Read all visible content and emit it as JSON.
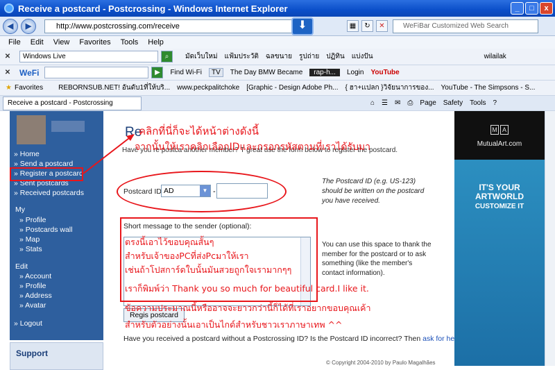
{
  "window": {
    "title": "Receive a postcard - Postcrossing - Windows Internet Explorer",
    "buttons": [
      "_",
      "□",
      "x"
    ]
  },
  "address_bar": {
    "url": "http://www.postcrossing.com/receive",
    "search_placeholder": "WeFiBar Customized Web Search"
  },
  "menu": [
    "File",
    "Edit",
    "View",
    "Favorites",
    "Tools",
    "Help"
  ],
  "toolbar_live": {
    "label": "Windows Live",
    "links": [
      "มัดเว็บใหม่",
      "แฟ้มประวัติ",
      "ฉลขนาย",
      "รูปถ่าย",
      "ปฏิทิน",
      "แบ่งปัน"
    ],
    "user": "wilailak"
  },
  "toolbar_wefi": {
    "label": "WeFi",
    "find_wifi": "Find Wi-Fi",
    "tv": "TV",
    "news": "The Day BMW Became",
    "media": "rap-h...",
    "login": "Login",
    "youtube": "YouTube"
  },
  "favorites_bar": {
    "label": "Favorites",
    "items": [
      "REBORNSUB.NET! อันดับ1ที่ให้บริ...",
      "www.peckpalitchoke",
      "[Graphic - Design Adobe Ph...",
      "{ ฮา+เเปลก }วิจัยนาการของ...",
      "YouTube - The Simpsons - S..."
    ]
  },
  "tab_bar": {
    "tab_title": "Receive a postcard - Postcrossing",
    "tools": [
      "Page",
      "Safety",
      "Tools"
    ]
  },
  "sidebar": {
    "links_main": [
      "» Home",
      "» Send a postcard",
      "» Register a postcard",
      "» Sent postcards",
      "» Received postcards"
    ],
    "my_heading": "My",
    "links_my": [
      "» Profile",
      "» Postcards wall",
      "» Map",
      "» Stats"
    ],
    "edit_heading": "Edit",
    "links_edit": [
      "» Account",
      "» Profile",
      "» Address",
      "» Avatar"
    ],
    "logout": "» Logout",
    "support": "Support"
  },
  "main": {
    "title": "Re",
    "intro": "Have you re                    postca                    another member? T            great            use the form below to register the postcard.",
    "postcard_id_label": "Postcard ID:",
    "postcard_id_prefix": "AD",
    "dash": "-",
    "hint": "The Postcard ID (e.g. US-123) should be written on the postcard you have received.",
    "message_label": "Short message to the sender (optional):",
    "message_hint": "You can use this space to thank the member for the postcard or to ask something (like the member's contact information).",
    "register_button": "Regis  postcard",
    "bottom_question": "Have you received a postcard without a Postcrossing ID? Is the Postcard ID incorrect? Then",
    "bottom_link": "ask for help",
    "bottom_end": ".",
    "copyright": "© Copyright 2004-2010 by Paulo Magalhães"
  },
  "ad": {
    "logo": [
      "M",
      "A"
    ],
    "brand": "MutualArt.com",
    "headline_1": "IT'S YOUR",
    "headline_2": "ARTWORLD",
    "cta": "CUSTOMIZE IT"
  },
  "annotations": {
    "a1": "คลิกที่นี่ก็จะได้หน้าต่างดังนี้",
    "a2": "จากนั้นให้เราคลิกเลือกIDและกรอกรหัสตามที่เราได้รับมา",
    "m1": "ตรงนี้เอาไว้ขอบคุณสั้นๆ",
    "m2": "สำหรับเจ้าของPCที่ส่งPcมาให้เรา",
    "m3": "เช่นถ้าโปสการ์ดใบนั้นมันสวยถูกใจเรามากๆๆ",
    "m4": "เราก็พิมพ์ว่า Thank you so much for beautiful card.I like it.",
    "m5": "ข้อความประมาณนี้หรืออาจจะยาวกว่านี้ก็ได้ที่เราอยากขอบคุณเค้า",
    "m6": "สำหรับตัวอย่างนั้นเอาเป็นไกด์สำหรับชาวเราภาษาเทพ ^^"
  },
  "colors": {
    "annotation_red": "#e8161b",
    "sidebar_blue": "#2e5f9e",
    "title_bar_blue": "#0b4fc9"
  }
}
